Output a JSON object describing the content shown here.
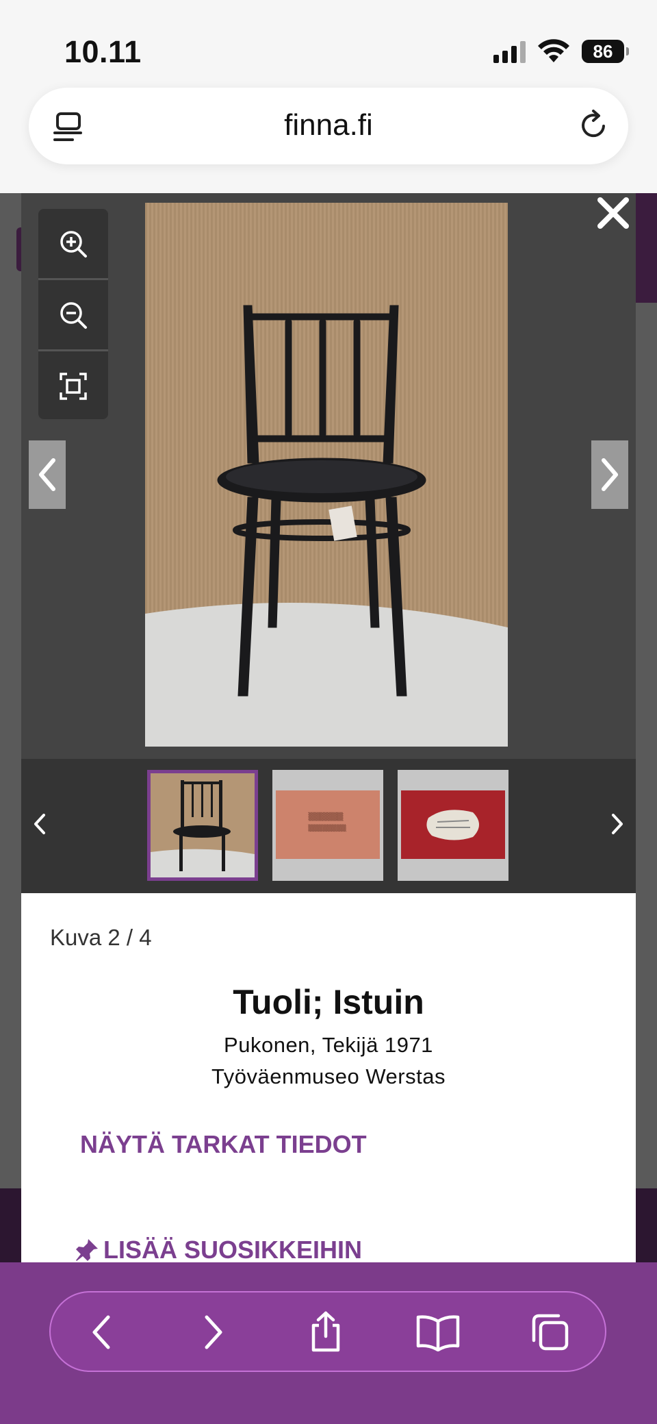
{
  "status_bar": {
    "time": "10.11",
    "battery": "86"
  },
  "url_bar": {
    "domain": "finna.fi"
  },
  "viewer": {
    "image_alt": "Tuoli; Istuin",
    "thumbnails": [
      {
        "name": "thumbnail-chair-front",
        "active": true
      },
      {
        "name": "thumbnail-stamp-closeup",
        "active": false
      },
      {
        "name": "thumbnail-label-closeup",
        "active": false
      }
    ]
  },
  "info": {
    "image_counter": "Kuva 2 / 4",
    "title": "Tuoli; Istuin",
    "creator_line": "Pukonen, Tekijä 1971",
    "organisation": "Työväenmuseo Werstas",
    "details_link": "NÄYTÄ TARKAT TIEDOT",
    "favorites_link": "LISÄÄ SUOSIKKEIHIN"
  },
  "colors": {
    "brand_purple": "#7b3f8f",
    "toolbar_purple": "#7c3b8a",
    "viewer_bg": "#444444"
  }
}
